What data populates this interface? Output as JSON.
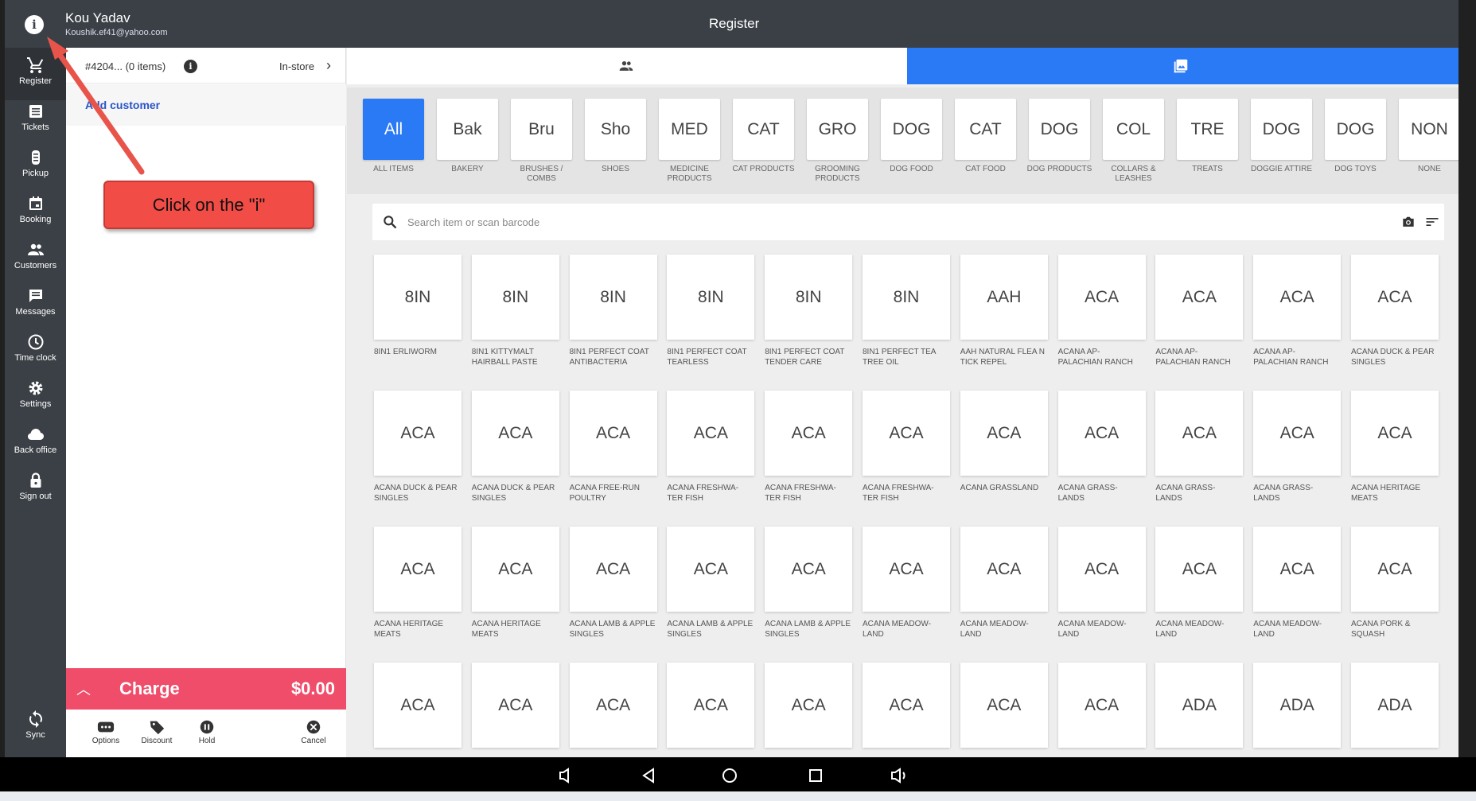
{
  "header": {
    "user_name": "Kou Yadav",
    "user_email": "Koushik.ef41@yahoo.com",
    "title": "Register"
  },
  "sidebar": {
    "items": [
      {
        "label": "Register",
        "icon": "cart-icon"
      },
      {
        "label": "Tickets",
        "icon": "tickets-icon"
      },
      {
        "label": "Pickup",
        "icon": "pickup-icon"
      },
      {
        "label": "Booking",
        "icon": "calendar-icon"
      },
      {
        "label": "Customers",
        "icon": "people-icon"
      },
      {
        "label": "Messages",
        "icon": "message-icon"
      },
      {
        "label": "Time clock",
        "icon": "clock-icon"
      },
      {
        "label": "Settings",
        "icon": "gear-icon"
      },
      {
        "label": "Back office",
        "icon": "cloud-icon"
      },
      {
        "label": "Sign out",
        "icon": "lock-icon"
      }
    ],
    "sync_label": "Sync"
  },
  "ticket": {
    "id_text": "#4204... (0 items)",
    "mode": "In-store",
    "add_customer": "Add customer",
    "charge_label": "Charge",
    "charge_amount": "$0.00",
    "actions": [
      "Options",
      "Discount",
      "Hold",
      "Cancel"
    ]
  },
  "categories": [
    {
      "abbr": "All",
      "label": "All items",
      "selected": true
    },
    {
      "abbr": "Bak",
      "label": "Bakery"
    },
    {
      "abbr": "Bru",
      "label": "Brushes / Combs"
    },
    {
      "abbr": "Sho",
      "label": "Shoes"
    },
    {
      "abbr": "MED",
      "label": "MEDICINE PRODUCTS"
    },
    {
      "abbr": "CAT",
      "label": "CAT PRODUCTS"
    },
    {
      "abbr": "GRO",
      "label": "GROOMING PRODUCTS"
    },
    {
      "abbr": "DOG",
      "label": "DOG FOOD"
    },
    {
      "abbr": "CAT",
      "label": "CAT FOOD"
    },
    {
      "abbr": "DOG",
      "label": "DOG PRODUCTS"
    },
    {
      "abbr": "COL",
      "label": "COLLARS & LEASHES"
    },
    {
      "abbr": "TRE",
      "label": "TREATS"
    },
    {
      "abbr": "DOG",
      "label": "DOGGIE ATTIRE"
    },
    {
      "abbr": "DOG",
      "label": "DOG TOYS"
    },
    {
      "abbr": "NON",
      "label": "NONE"
    }
  ],
  "search": {
    "placeholder": "Search item or scan barcode"
  },
  "items": [
    {
      "abbr": "8IN",
      "label": "8IN1 ERLIWORM"
    },
    {
      "abbr": "8IN",
      "label": "8IN1 KITTYMALT HAIRBALL PASTE"
    },
    {
      "abbr": "8IN",
      "label": "8IN1 PERFECT COAT ANTIBACTERIA"
    },
    {
      "abbr": "8IN",
      "label": "8IN1 PERFECT COAT TEARLESS"
    },
    {
      "abbr": "8IN",
      "label": "8IN1 PERFECT COAT TENDER CARE"
    },
    {
      "abbr": "8IN",
      "label": "8IN1 PERFECT TEA TREE OIL"
    },
    {
      "abbr": "AAH",
      "label": "AAH NATURAL FLEA N TICK REPEL"
    },
    {
      "abbr": "ACA",
      "label": "ACANA AP-PALACHIAN RANCH"
    },
    {
      "abbr": "ACA",
      "label": "ACANA AP-PALACHIAN RANCH"
    },
    {
      "abbr": "ACA",
      "label": "ACANA AP-PALACHIAN RANCH"
    },
    {
      "abbr": "ACA",
      "label": "ACANA DUCK & PEAR SINGLES"
    },
    {
      "abbr": "ACA",
      "label": "ACANA DUCK & PEAR SINGLES"
    },
    {
      "abbr": "ACA",
      "label": "ACANA DUCK & PEAR SINGLES"
    },
    {
      "abbr": "ACA",
      "label": "ACANA FREE-RUN POULTRY"
    },
    {
      "abbr": "ACA",
      "label": "ACANA FRESHWA-TER FISH"
    },
    {
      "abbr": "ACA",
      "label": "ACANA FRESHWA-TER FISH"
    },
    {
      "abbr": "ACA",
      "label": "ACANA FRESHWA-TER FISH"
    },
    {
      "abbr": "ACA",
      "label": "ACANA GRASSLAND"
    },
    {
      "abbr": "ACA",
      "label": "ACANA GRASS-LANDS"
    },
    {
      "abbr": "ACA",
      "label": "ACANA GRASS-LANDS"
    },
    {
      "abbr": "ACA",
      "label": "ACANA GRASS-LANDS"
    },
    {
      "abbr": "ACA",
      "label": "ACANA HERITAGE MEATS"
    },
    {
      "abbr": "ACA",
      "label": "ACANA HERITAGE MEATS"
    },
    {
      "abbr": "ACA",
      "label": "ACANA HERITAGE MEATS"
    },
    {
      "abbr": "ACA",
      "label": "ACANA LAMB & APPLE SINGLES"
    },
    {
      "abbr": "ACA",
      "label": "ACANA LAMB & APPLE SINGLES"
    },
    {
      "abbr": "ACA",
      "label": "ACANA LAMB & APPLE SINGLES"
    },
    {
      "abbr": "ACA",
      "label": "ACANA MEADOW-LAND"
    },
    {
      "abbr": "ACA",
      "label": "ACANA MEADOW-LAND"
    },
    {
      "abbr": "ACA",
      "label": "ACANA MEADOW-LAND"
    },
    {
      "abbr": "ACA",
      "label": "ACANA MEADOW-LAND"
    },
    {
      "abbr": "ACA",
      "label": "ACANA MEADOW-LAND"
    },
    {
      "abbr": "ACA",
      "label": "ACANA PORK & SQUASH"
    },
    {
      "abbr": "ACA",
      "label": ""
    },
    {
      "abbr": "ACA",
      "label": ""
    },
    {
      "abbr": "ACA",
      "label": ""
    },
    {
      "abbr": "ACA",
      "label": ""
    },
    {
      "abbr": "ACA",
      "label": ""
    },
    {
      "abbr": "ACA",
      "label": ""
    },
    {
      "abbr": "ACA",
      "label": ""
    },
    {
      "abbr": "ACA",
      "label": ""
    },
    {
      "abbr": "ADA",
      "label": ""
    },
    {
      "abbr": "ADA",
      "label": ""
    },
    {
      "abbr": "ADA",
      "label": ""
    }
  ],
  "callout": {
    "text": "Click on the \"i\""
  },
  "colors": {
    "accent": "#2a79f5",
    "charge": "#ef4d6a",
    "sidebar": "#3b4046",
    "callout": "#f14c46"
  }
}
